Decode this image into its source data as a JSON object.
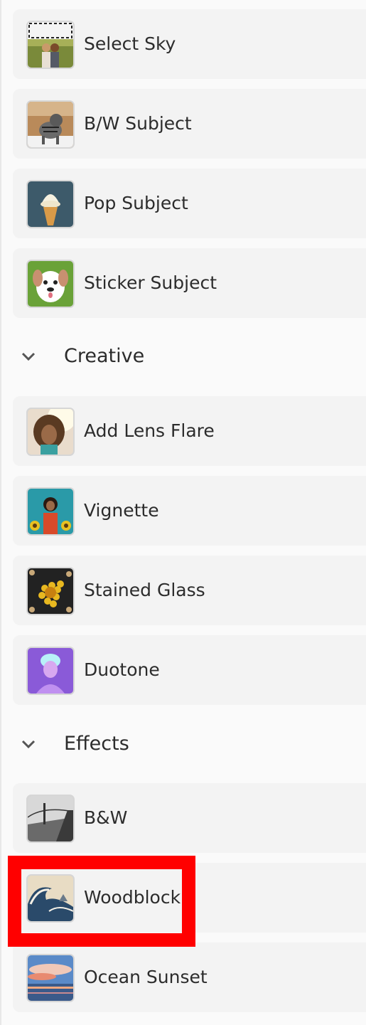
{
  "groups": [
    {
      "title": null,
      "items": [
        {
          "label": "Select Sky",
          "icon": "select-sky-thumbnail"
        },
        {
          "label": "B/W Subject",
          "icon": "bw-subject-thumbnail"
        },
        {
          "label": "Pop Subject",
          "icon": "pop-subject-thumbnail"
        },
        {
          "label": "Sticker Subject",
          "icon": "sticker-subject-thumbnail"
        }
      ]
    },
    {
      "title": "Creative",
      "items": [
        {
          "label": "Add Lens Flare",
          "icon": "lens-flare-thumbnail"
        },
        {
          "label": "Vignette",
          "icon": "vignette-thumbnail"
        },
        {
          "label": "Stained Glass",
          "icon": "stained-glass-thumbnail"
        },
        {
          "label": "Duotone",
          "icon": "duotone-thumbnail"
        }
      ]
    },
    {
      "title": "Effects",
      "items": [
        {
          "label": "B&W",
          "icon": "bw-thumbnail"
        },
        {
          "label": "Woodblock",
          "icon": "woodblock-thumbnail",
          "highlighted": true
        },
        {
          "label": "Ocean Sunset",
          "icon": "ocean-sunset-thumbnail"
        }
      ]
    }
  ],
  "highlight_color": "#ff0000"
}
